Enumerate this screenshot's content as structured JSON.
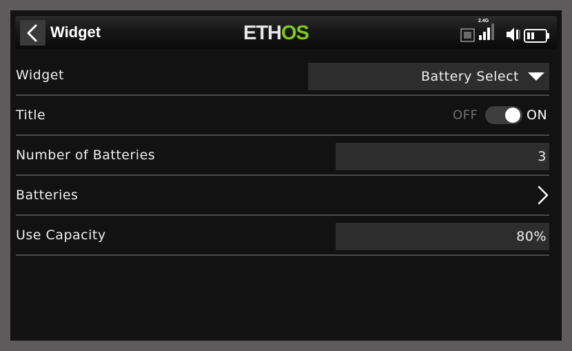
{
  "header": {
    "title": "Widget",
    "logo": {
      "eth": "ETH",
      "os": "OS"
    },
    "status": {
      "record_icon": "record-icon",
      "signal_label": "2.4G",
      "signal_icon": "signal-bars-icon",
      "volume_icon": "speaker-icon",
      "battery_icon": "battery-icon"
    }
  },
  "settings": {
    "widget": {
      "label": "Widget",
      "value": "Battery Select"
    },
    "title": {
      "label": "Title",
      "off_label": "OFF",
      "on_label": "ON",
      "enabled": true
    },
    "num_batteries": {
      "label": "Number of Batteries",
      "value": "3"
    },
    "batteries": {
      "label": "Batteries"
    },
    "use_capacity": {
      "label": "Use Capacity",
      "value": "80%"
    }
  },
  "colors": {
    "background": "#121212",
    "frame": "#5d5b5c",
    "field": "#2d2d2d",
    "accent": "#7fc722",
    "divider": "#4a4a4a"
  }
}
